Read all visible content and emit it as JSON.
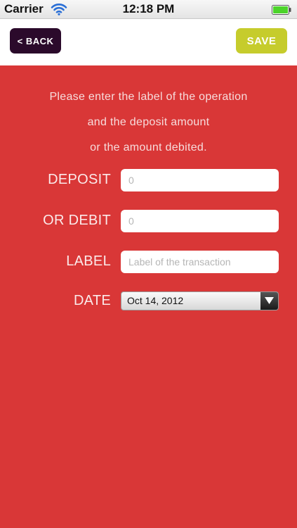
{
  "status_bar": {
    "carrier": "Carrier",
    "time": "12:18 PM"
  },
  "nav": {
    "back_label": "< BACK",
    "save_label": "SAVE"
  },
  "instructions": {
    "line1": "Please enter the label of the operation",
    "line2": "and the deposit amount",
    "line3": "or the amount debited."
  },
  "form": {
    "deposit": {
      "label": "DEPOSIT",
      "placeholder": "0",
      "value": ""
    },
    "debit": {
      "label": "OR DEBIT",
      "placeholder": "0",
      "value": ""
    },
    "transaction_label": {
      "label": "LABEL",
      "placeholder": "Label of the transaction",
      "value": ""
    },
    "date": {
      "label": "DATE",
      "value": "Oct 14, 2012"
    }
  },
  "colors": {
    "background": "#d93737",
    "back_button": "#2b0a2b",
    "save_button": "#c6cc2c",
    "battery": "#4cd42a"
  },
  "icons": {
    "wifi": "wifi-icon",
    "battery": "battery-icon",
    "dropdown": "chevron-down-icon"
  }
}
